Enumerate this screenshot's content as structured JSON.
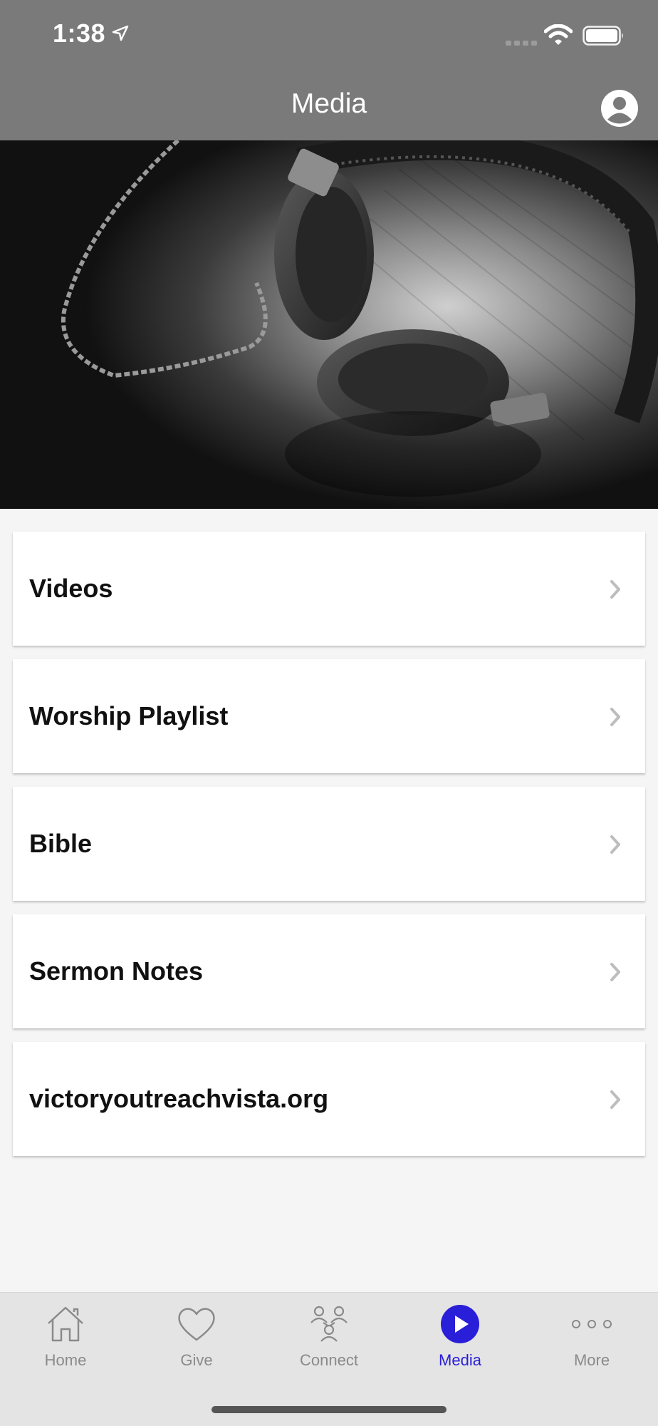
{
  "status_bar": {
    "time": "1:38"
  },
  "nav": {
    "title": "Media"
  },
  "menu": [
    {
      "label": "Videos"
    },
    {
      "label": "Worship Playlist"
    },
    {
      "label": "Bible"
    },
    {
      "label": "Sermon Notes"
    },
    {
      "label": "victoryoutreachvista.org"
    }
  ],
  "tabs": [
    {
      "label": "Home",
      "icon": "home-icon"
    },
    {
      "label": "Give",
      "icon": "heart-icon"
    },
    {
      "label": "Connect",
      "icon": "people-icon"
    },
    {
      "label": "Media",
      "icon": "play-icon",
      "active": true
    },
    {
      "label": "More",
      "icon": "more-icon"
    }
  ],
  "colors": {
    "header": "#7a7a7a",
    "accent": "#2a1fd8",
    "background": "#f5f5f5",
    "tab_bar": "#e4e4e4"
  }
}
